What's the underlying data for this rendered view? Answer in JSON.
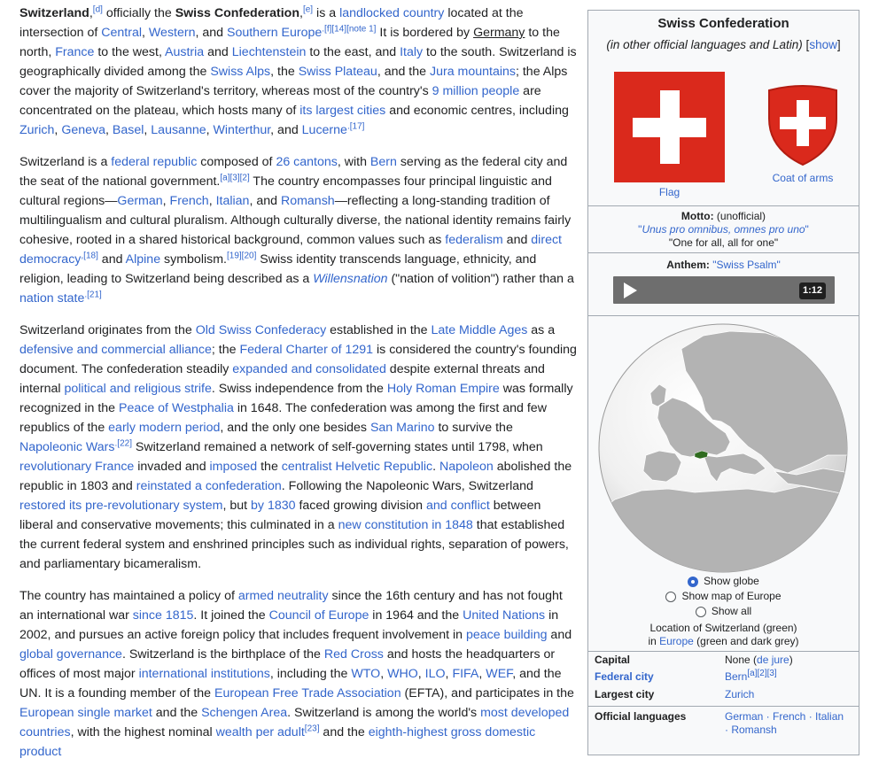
{
  "article": {
    "p1": {
      "s1_bold": "Switzerland",
      "fn_d": "[d]",
      "s2": " officially the ",
      "s3_bold": "Swiss Confederation",
      "fn_e": "[e]",
      "s4": " is a ",
      "l_landlocked": "landlocked country",
      "s5": " located at the intersection of ",
      "l_central": "Central",
      "c1": ", ",
      "l_western": "Western",
      "s6": ", and ",
      "l_southern": "Southern Europe",
      "fn_f": ".[f][14][note 1]",
      "s7": " It is bordered by ",
      "l_germany": "Germany",
      "s8": " to the north, ",
      "l_france": "France",
      "s9": " to the west, ",
      "l_austria": "Austria",
      "s10": " and ",
      "l_liechtenstein": "Liechtenstein",
      "s11": " to the east, and ",
      "l_italy": "Italy",
      "s12": " to the south. Switzerland is geographically divided among the ",
      "l_alps": "Swiss Alps",
      "c2": ", the ",
      "l_plateau": "Swiss Plateau",
      "s13": ", and the ",
      "l_jura": "Jura mountains",
      "s14": "; the Alps cover the majority of Switzerland's territory, whereas most of the country's ",
      "l_9m": "9 million people",
      "s15": " are concentrated on the plateau, which hosts many of ",
      "l_cities": "its largest cities",
      "s16": " and economic centres, including ",
      "l_zurich": "Zurich",
      "l_geneva": "Geneva",
      "l_basel": "Basel",
      "l_lausanne": "Lausanne",
      "l_winterthur": "Winterthur",
      "l_lucerne": "Lucerne",
      "fn_17": ".[17]"
    },
    "p2": {
      "s1": "Switzerland is a ",
      "l_fedrep": "federal republic",
      "s2": " composed of ",
      "l_cantons": "26 cantons",
      "s3": ", with ",
      "l_bern": "Bern",
      "s4": " serving as the federal city and the seat of the national government.",
      "fn_a": "[a][3][2]",
      "s5": " The country encompasses four principal linguistic and cultural regions—",
      "l_german": "German",
      "l_french": "French",
      "l_italian": "Italian",
      "s6": ", and ",
      "l_romansh": "Romansh",
      "s7": "—reflecting a long-standing tradition of multilingualism and cultural pluralism. Although culturally diverse, the national identity remains fairly cohesive, rooted in a shared historical background, common values such as ",
      "l_federalism": "federalism",
      "s8": " and ",
      "l_directdem": "direct democracy",
      "fn_18": ",[18]",
      "s9": " and ",
      "l_alpine": "Alpine",
      "s10": " symbolism.",
      "fn_19": "[19][20]",
      "s11": " Swiss identity transcends language, ethnicity, and religion, leading to Switzerland being described as a ",
      "l_willen": "Willensnation",
      "s12": " (\"nation of volition\") rather than a ",
      "l_nationstate": "nation state",
      "fn_21": ".[21]"
    },
    "p3": {
      "s1": "Switzerland originates from the ",
      "l_oldswiss": "Old Swiss Confederacy",
      "s2": " established in the ",
      "l_lma": "Late Middle Ages",
      "s3": " as a ",
      "l_alliance": "defensive and commercial alliance",
      "s4": "; the ",
      "l_charter": "Federal Charter of 1291",
      "s5": " is considered the country's founding document. The confederation steadily ",
      "l_expanded": "expanded and consolidated",
      "s6": " despite external threats and internal ",
      "l_strife": "political and religious strife",
      "s7": ". Swiss independence from the ",
      "l_hre": "Holy Roman Empire",
      "s8": " was formally recognized in the ",
      "l_westphalia": "Peace of Westphalia",
      "s9": " in 1648. The confederation was among the first and few republics of the ",
      "l_earlymod": "early modern period",
      "s10": ", and the only one besides ",
      "l_sanmarino": "San Marino",
      "s11": " to survive the ",
      "l_napwars": "Napoleonic Wars",
      "fn_22": ".[22]",
      "s12": " Switzerland remained a network of self-governing states until 1798, when ",
      "l_revfrance": "revolutionary France",
      "s13": " invaded and ",
      "l_imposed": "imposed",
      "s14": " the ",
      "l_helvetic": "centralist Helvetic Republic",
      "s15": ". ",
      "l_napoleon": "Napoleon",
      "s16": " abolished the republic in 1803 and ",
      "l_reinstated": "reinstated a confederation",
      "s17": ". Following the Napoleonic Wars, Switzerland ",
      "l_restored": "restored its pre-revolutionary system",
      "s18": ", but ",
      "l_by1830": "by 1830",
      "s19": " faced growing division ",
      "l_conflict": "and conflict",
      "s20": " between liberal and conservative movements; this culminated in a ",
      "l_const": "new constitution in 1848",
      "s21": " that established the current federal system and enshrined principles such as individual rights, separation of powers, and parliamentary bicameralism."
    },
    "p4": {
      "s1": "The country has maintained a policy of ",
      "l_neutral": "armed neutrality",
      "s2": " since the 16th century and has not fought an international war ",
      "l_1815": "since 1815",
      "s3": ". It joined the ",
      "l_coe": "Council of Europe",
      "s4": " in 1964 and the ",
      "l_un": "United Nations",
      "s5": " in 2002, and pursues an active foreign policy that includes frequent involvement in ",
      "l_peace": "peace building",
      "s6": " and ",
      "l_globalgov": "global governance",
      "s7": ". Switzerland is the birthplace of the ",
      "l_redcross": "Red Cross",
      "s8": " and hosts the headquarters or offices of most major ",
      "l_intinst": "international institutions",
      "s9": ", including the ",
      "l_wto": "WTO",
      "l_who": "WHO",
      "l_ilo": "ILO",
      "l_fifa": "FIFA",
      "l_wef": "WEF",
      "s10": ", and the UN. It is a founding member of the ",
      "l_efta": "European Free Trade Association",
      "s11": " (EFTA), and participates in the ",
      "l_esm": "European single market",
      "s12": " and the ",
      "l_schengen": "Schengen Area",
      "s13": ". Switzerland is among the world's ",
      "l_mostdev": "most developed countries",
      "s14": ", with the highest nominal ",
      "l_wealth": "wealth per adult",
      "fn_23": "[23]",
      "s15": " and the ",
      "l_gdp": "eighth-highest gross domestic product"
    },
    "and_sep": ", and ",
    "comma": ", "
  },
  "infobox": {
    "title": "Swiss Confederation",
    "subtitle": "(in other official languages and Latin)",
    "show_open": " [",
    "show_label": "show",
    "show_close": "]",
    "flag_caption": "Flag",
    "coa_caption": "Coat of arms",
    "motto_label": "Motto:",
    "motto_note": " (unofficial)",
    "motto_latin": "Unus pro omnibus, omnes pro uno",
    "motto_trans": "\"One for all, all for one\"",
    "anthem_label": "Anthem:",
    "anthem_link": "\"Swiss Psalm\"",
    "audio_time": "1:12",
    "radio_globe": "Show globe",
    "radio_map": "Show map of Europe",
    "radio_all": "Show all",
    "loc_line1": "Location of Switzerland (green)",
    "loc_in": "in ",
    "loc_europe": "Europe",
    "loc_rest": " (green and dark grey)",
    "capital_label": "Capital",
    "capital_value": "None (",
    "capital_link": "de jure",
    "capital_close": ")",
    "fedcity_label": "Federal city",
    "fedcity_value": "Bern",
    "fedcity_fn": "[a][2][3]",
    "largest_label": "Largest city",
    "largest_value": "Zurich",
    "langs_label": "Official languages",
    "langs_value_1": "German · French · Italian",
    "langs_value_2": "· Romansh"
  },
  "colors": {
    "link": "#3366cc",
    "text": "#202122",
    "infobox_bg": "#f8f9fa",
    "infobox_border": "#a2a9b1",
    "flag_red": "#da291c",
    "switzerland_highlight": "#2f6b1f"
  }
}
